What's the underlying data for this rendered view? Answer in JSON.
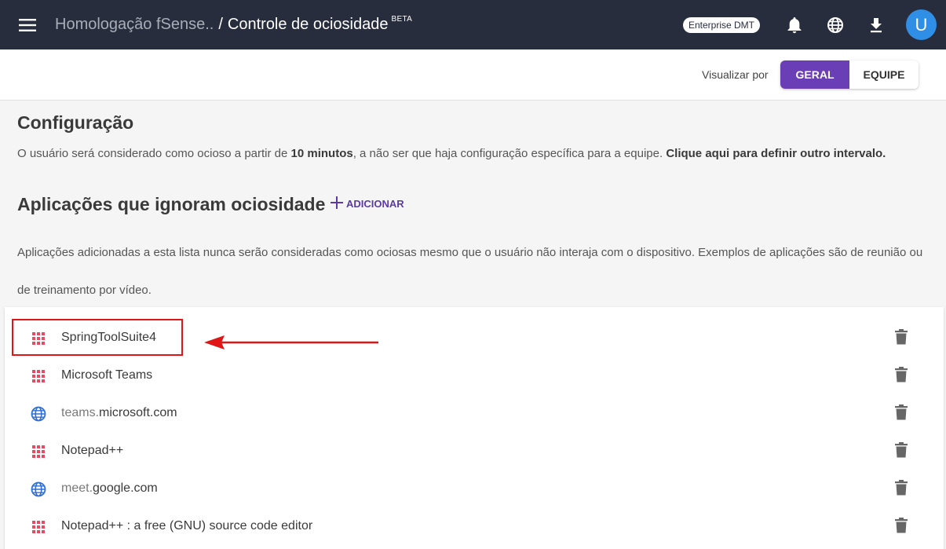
{
  "header": {
    "breadcrumb_parent": "Homologação fSense..",
    "separator": "/",
    "title": "Controle de ociosidade",
    "beta": "BETA",
    "badge": "Enterprise DMT",
    "avatar_letter": "U"
  },
  "toolbar": {
    "view_label": "Visualizar por",
    "options": [
      {
        "label": "GERAL",
        "active": true
      },
      {
        "label": "EQUIPE",
        "active": false
      }
    ]
  },
  "config": {
    "heading": "Configuração",
    "text_before": "O usuário será considerado como ocioso a partir de ",
    "duration": "10 minutos",
    "text_after": ", a não ser que haja configuração específica para a equipe. ",
    "link": "Clique aqui para definir outro intervalo."
  },
  "apps": {
    "heading": "Aplicações que ignoram ociosidade",
    "add_label": "ADICIONAR",
    "description": "Aplicações adicionadas a esta lista nunca serão consideradas como ociosas mesmo que o usuário não interaja com o dispositivo. Exemplos de aplicações são de reunião ou de treinamento por vídeo.",
    "items": [
      {
        "type": "app",
        "name": "SpringToolSuite4"
      },
      {
        "type": "app",
        "name": "Microsoft Teams"
      },
      {
        "type": "web",
        "sub": "teams.",
        "domain": "microsoft.com"
      },
      {
        "type": "app",
        "name": "Notepad++"
      },
      {
        "type": "web",
        "sub": "meet.",
        "domain": "google.com"
      },
      {
        "type": "app",
        "name": "Notepad++ : a free (GNU) source code editor"
      }
    ]
  },
  "colors": {
    "topbar": "#272d3d",
    "accent": "#6a3fb5",
    "app_icon": "#e84a5f",
    "web_icon": "#2f6fd6",
    "annotation": "#e01515"
  }
}
